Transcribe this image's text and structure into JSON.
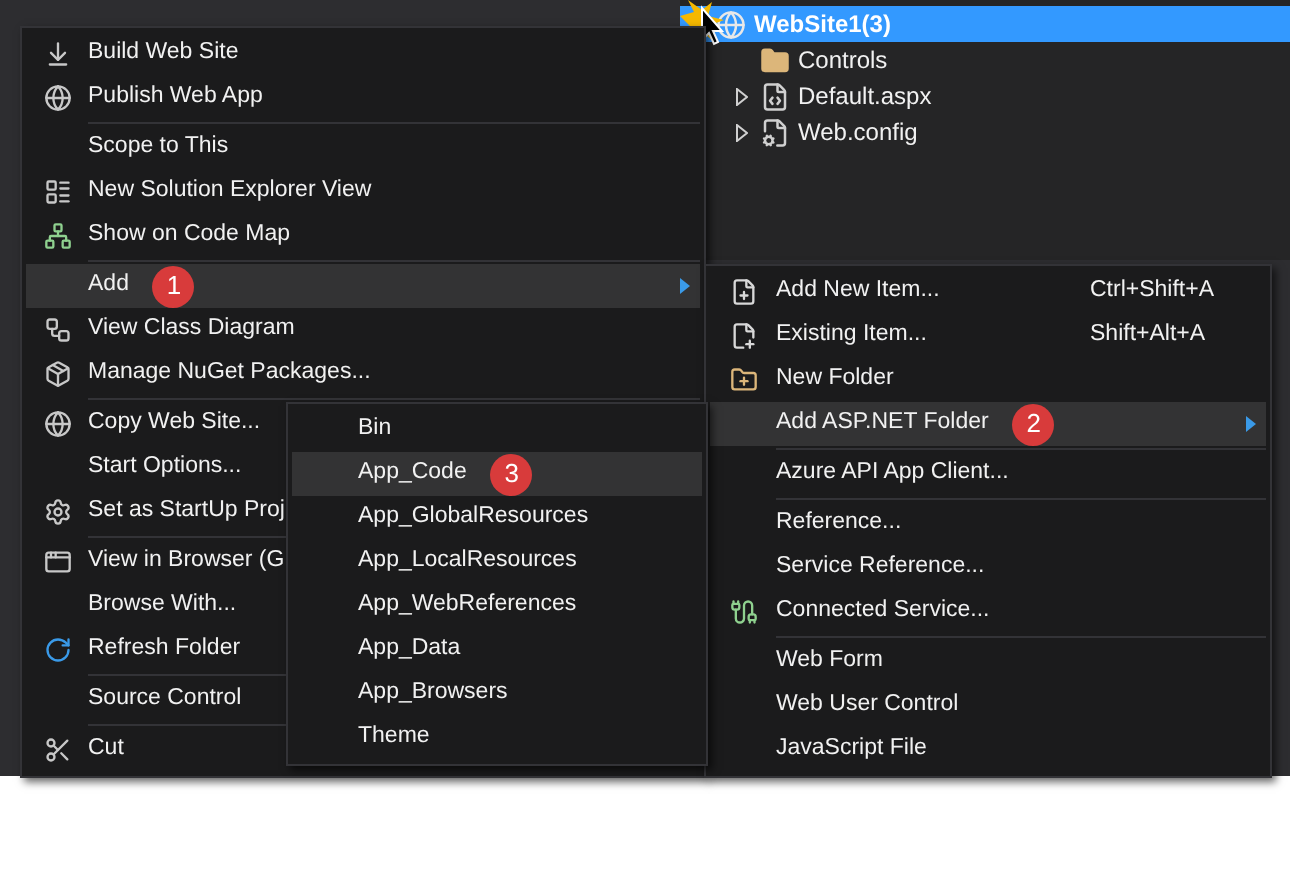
{
  "solution_explorer": {
    "root": {
      "label": "WebSite1(3)",
      "selected": true,
      "children": [
        {
          "label": "Controls",
          "selected": false,
          "expandable": false
        },
        {
          "label": "Default.aspx",
          "selected": false,
          "expandable": true
        },
        {
          "label": "Web.config",
          "selected": false,
          "expandable": true
        }
      ]
    }
  },
  "context_menu": {
    "items": [
      {
        "kind": "item",
        "label": "Build Web Site",
        "selected": false,
        "submenu": false
      },
      {
        "kind": "item",
        "label": "Publish Web App",
        "selected": false,
        "submenu": false
      },
      {
        "kind": "separator"
      },
      {
        "kind": "item",
        "label": "Scope to This",
        "selected": false,
        "submenu": false
      },
      {
        "kind": "item",
        "label": "New Solution Explorer View",
        "selected": false,
        "submenu": false
      },
      {
        "kind": "item",
        "label": "Show on Code Map",
        "selected": false,
        "submenu": false
      },
      {
        "kind": "separator"
      },
      {
        "kind": "item",
        "label": "Add",
        "selected": true,
        "submenu": true,
        "badge": "1"
      },
      {
        "kind": "item",
        "label": "View Class Diagram",
        "selected": false,
        "submenu": false
      },
      {
        "kind": "item",
        "label": "Manage NuGet Packages...",
        "selected": false,
        "submenu": false
      },
      {
        "kind": "separator"
      },
      {
        "kind": "item",
        "label": "Copy Web Site...",
        "selected": false,
        "submenu": false
      },
      {
        "kind": "item",
        "label": "Start Options...",
        "selected": false,
        "submenu": false
      },
      {
        "kind": "item",
        "label": "Set as StartUp Proj",
        "selected": false,
        "submenu": false
      },
      {
        "kind": "separator"
      },
      {
        "kind": "item",
        "label": "View in Browser (G",
        "selected": false,
        "submenu": false
      },
      {
        "kind": "item",
        "label": "Browse With...",
        "selected": false,
        "submenu": false
      },
      {
        "kind": "item",
        "label": "Refresh Folder",
        "selected": false,
        "submenu": false
      },
      {
        "kind": "separator"
      },
      {
        "kind": "item",
        "label": "Source Control",
        "selected": false,
        "submenu": false
      },
      {
        "kind": "separator"
      },
      {
        "kind": "item",
        "label": "Cut",
        "selected": false,
        "submenu": false
      }
    ]
  },
  "add_menu": {
    "items": [
      {
        "kind": "item",
        "label": "Add New Item...",
        "shortcut": "Ctrl+Shift+A",
        "selected": false,
        "submenu": false
      },
      {
        "kind": "item",
        "label": "Existing Item...",
        "shortcut": "Shift+Alt+A",
        "selected": false,
        "submenu": false
      },
      {
        "kind": "item",
        "label": "New Folder",
        "selected": false,
        "submenu": false
      },
      {
        "kind": "item",
        "label": "Add ASP.NET Folder",
        "selected": true,
        "submenu": true,
        "badge": "2"
      },
      {
        "kind": "separator"
      },
      {
        "kind": "item",
        "label": "Azure API App Client...",
        "selected": false,
        "submenu": false
      },
      {
        "kind": "separator"
      },
      {
        "kind": "item",
        "label": "Reference...",
        "selected": false,
        "submenu": false
      },
      {
        "kind": "item",
        "label": "Service Reference...",
        "selected": false,
        "submenu": false
      },
      {
        "kind": "item",
        "label": "Connected Service...",
        "selected": false,
        "submenu": false
      },
      {
        "kind": "separator"
      },
      {
        "kind": "item",
        "label": "Web Form",
        "selected": false,
        "submenu": false
      },
      {
        "kind": "item",
        "label": "Web User Control",
        "selected": false,
        "submenu": false
      },
      {
        "kind": "item",
        "label": "JavaScript File",
        "selected": false,
        "submenu": false
      }
    ]
  },
  "asp_net_folder_menu": {
    "items": [
      {
        "kind": "item",
        "label": "Bin",
        "selected": false,
        "submenu": false
      },
      {
        "kind": "item",
        "label": "App_Code",
        "selected": true,
        "submenu": false,
        "badge": "3"
      },
      {
        "kind": "item",
        "label": "App_GlobalResources",
        "selected": false,
        "submenu": false
      },
      {
        "kind": "item",
        "label": "App_LocalResources",
        "selected": false,
        "submenu": false
      },
      {
        "kind": "item",
        "label": "App_WebReferences",
        "selected": false,
        "submenu": false
      },
      {
        "kind": "item",
        "label": "App_Data",
        "selected": false,
        "submenu": false
      },
      {
        "kind": "item",
        "label": "App_Browsers",
        "selected": false,
        "submenu": false
      },
      {
        "kind": "item",
        "label": "Theme",
        "selected": false,
        "submenu": false
      }
    ]
  }
}
